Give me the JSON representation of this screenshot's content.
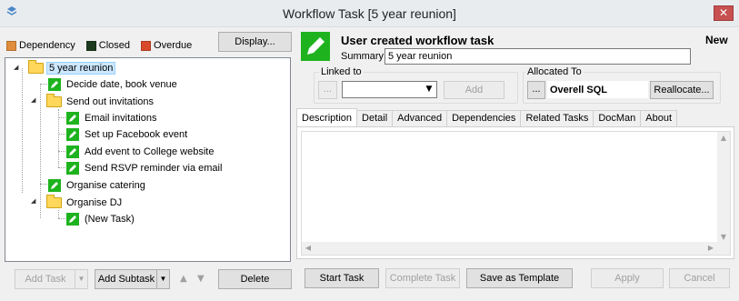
{
  "window": {
    "title": "Workflow Task  [5 year reunion]",
    "close_label": "✕"
  },
  "colors": {
    "dependency": "#e08d3c",
    "closed": "#1e3a1e",
    "overdue": "#d94a2b",
    "task_green": "#1eb31e",
    "folder_yellow": "#ffd75a"
  },
  "legend": {
    "dependency": "Dependency",
    "closed": "Closed",
    "overdue": "Overdue"
  },
  "display_button": "Display...",
  "tree": {
    "nodes": [
      {
        "label": "5 year reunion",
        "icon": "folder-icon",
        "selected": true
      },
      {
        "label": "Decide date, book venue",
        "icon": "task-icon"
      },
      {
        "label": "Send out invitations",
        "icon": "folder-icon"
      },
      {
        "label": "Email invitations",
        "icon": "task-icon"
      },
      {
        "label": "Set up Facebook event",
        "icon": "task-icon"
      },
      {
        "label": "Add event to College website",
        "icon": "task-icon"
      },
      {
        "label": "Send RSVP reminder via email",
        "icon": "task-icon"
      },
      {
        "label": "Organise catering",
        "icon": "task-icon"
      },
      {
        "label": "Organise DJ",
        "icon": "folder-icon"
      },
      {
        "label": "(New Task)",
        "icon": "task-icon"
      }
    ]
  },
  "left_buttons": {
    "add_task": "Add Task",
    "add_subtask": "Add Subtask",
    "delete": "Delete"
  },
  "task": {
    "heading": "User created workflow task",
    "status": "New",
    "summary_label": "Summary:",
    "summary_value": "5 year reunion"
  },
  "linked_to": {
    "label": "Linked to",
    "browse": "...",
    "selected": "",
    "add": "Add"
  },
  "allocated_to": {
    "label": "Allocated To",
    "browse": "...",
    "owner": "Overell SQL",
    "reallocate": "Reallocate..."
  },
  "tabs": [
    "Description",
    "Detail",
    "Advanced",
    "Dependencies",
    "Related Tasks",
    "DocMan",
    "About"
  ],
  "description_text": "",
  "bottom_buttons": {
    "start_task": "Start Task",
    "complete_task": "Complete Task",
    "save_template": "Save as Template",
    "apply": "Apply",
    "cancel": "Cancel"
  }
}
